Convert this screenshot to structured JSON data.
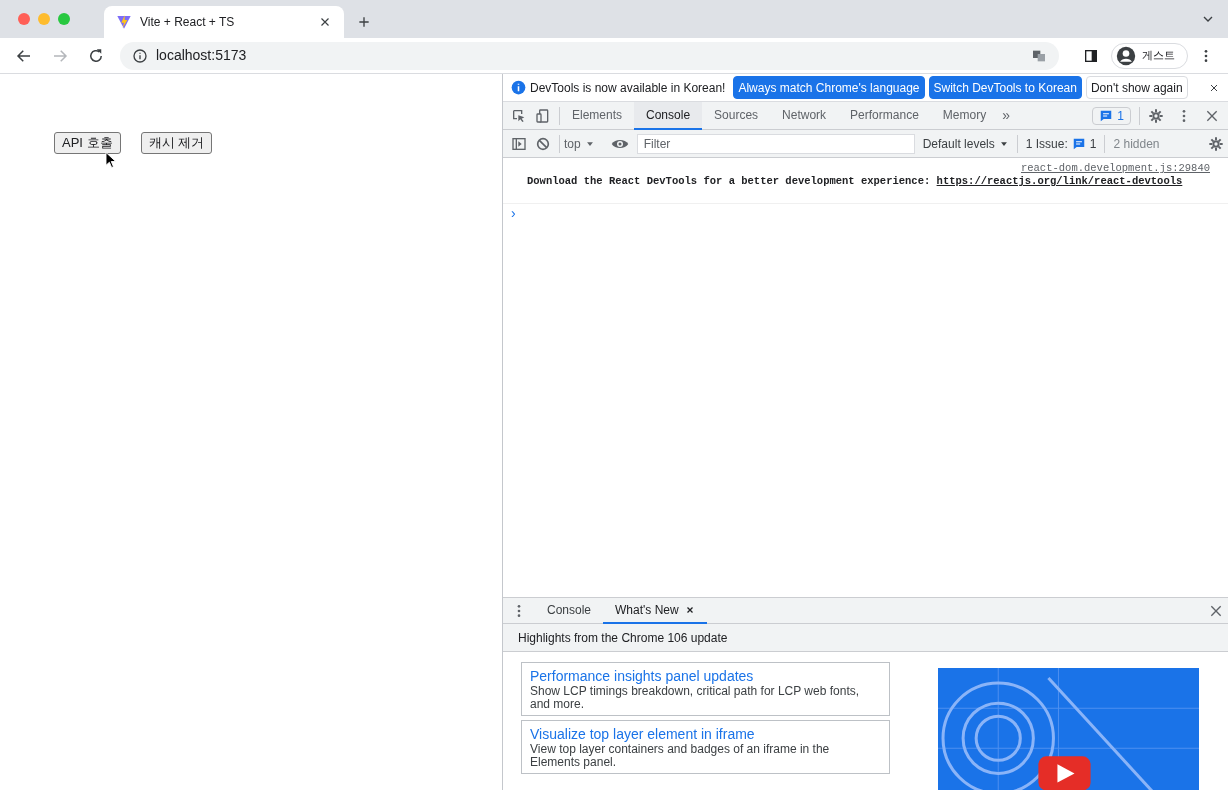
{
  "browser": {
    "tab": {
      "title": "Vite + React + TS"
    },
    "nav": [
      {
        "kind": "back",
        "disabled": false
      },
      {
        "kind": "forward",
        "disabled": true
      },
      {
        "kind": "reload",
        "disabled": false
      }
    ],
    "address": "localhost:5173",
    "profile": "게스트"
  },
  "page": {
    "buttons": [
      "API 호출",
      "캐시 제거"
    ]
  },
  "devtools": {
    "infobar": {
      "message": "DevTools is now available in Korean!",
      "buttons": [
        {
          "label": "Always match Chrome's language",
          "kind": "primary"
        },
        {
          "label": "Switch DevTools to Korean",
          "kind": "primary"
        },
        {
          "label": "Don't show again",
          "kind": "secondary"
        }
      ]
    },
    "tabs": [
      {
        "label": "Elements",
        "selected": false
      },
      {
        "label": "Console",
        "selected": true
      },
      {
        "label": "Sources",
        "selected": false
      },
      {
        "label": "Network",
        "selected": false
      },
      {
        "label": "Performance",
        "selected": false
      },
      {
        "label": "Memory",
        "selected": false
      }
    ],
    "overflow": "»",
    "messages_badge": "1",
    "console_toolbar": {
      "context": "top",
      "filter_placeholder": "Filter",
      "levels": "Default levels",
      "issues_label": "1 Issue:",
      "issues_count": "1",
      "hidden": "2 hidden"
    },
    "messages": [
      {
        "source": "react-dom.development.js:29840",
        "text": "Download the React DevTools for a better development experience: ",
        "link": "https://reactjs.org/link/react-devtools"
      }
    ],
    "prompt": "›",
    "drawer": {
      "tabs": [
        {
          "label": "Console",
          "selected": false,
          "closable": false
        },
        {
          "label": "What's New",
          "selected": true,
          "closable": true
        }
      ],
      "header": "Highlights from the Chrome 106 update",
      "items": [
        {
          "title": "Performance insights panel updates",
          "description": "Show LCP timings breakdown, critical path for LCP web fonts, and more."
        },
        {
          "title": "Visualize top layer element in iframe",
          "description": "View top layer containers and badges of an iframe in the Elements panel."
        }
      ]
    }
  }
}
